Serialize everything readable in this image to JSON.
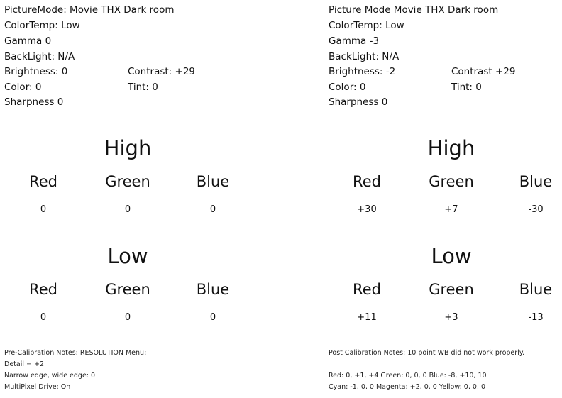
{
  "pre": {
    "settings": [
      "PictureMode: Movie THX Dark room",
      "ColorTemp: Low",
      "Gamma  0",
      "BackLight: N/A",
      "Brightness: 0",
      "Color: 0",
      "Sharpness  0"
    ],
    "contrast": "Contrast: +29",
    "tint": "Tint: 0",
    "high": {
      "title": "High",
      "labels": [
        "Red",
        "Green",
        "Blue"
      ],
      "values": [
        "0",
        "0",
        "0"
      ]
    },
    "low": {
      "title": "Low",
      "labels": [
        "Red",
        "Green",
        "Blue"
      ],
      "values": [
        "0",
        "0",
        "0"
      ]
    },
    "notes": [
      "Pre-Calibration Notes: RESOLUTION Menu:",
      "Detail = +2",
      "Narrow edge, wide edge: 0",
      "MultiPixel Drive: On"
    ]
  },
  "post": {
    "settings": [
      "Picture Mode  Movie THX Dark room",
      "ColorTemp: Low",
      "Gamma  -3",
      "BackLight: N/A",
      "Brightness: -2",
      "Color: 0",
      "Sharpness  0"
    ],
    "contrast": "Contrast  +29",
    "tint": "Tint: 0",
    "high": {
      "title": "High",
      "labels": [
        "Red",
        "Green",
        "Blue"
      ],
      "values": [
        "+30",
        "+7",
        "-30"
      ]
    },
    "low": {
      "title": "Low",
      "labels": [
        "Red",
        "Green",
        "Blue"
      ],
      "values": [
        "+11",
        "+3",
        "-13"
      ]
    },
    "notes": [
      "Post Calibration Notes: 10 point WB did not work properly.",
      "Red: 0, +1, +4 Green: 0, 0, 0 Blue: -8, +10, 10",
      "Cyan: -1, 0, 0 Magenta: +2, 0, 0 Yellow: 0, 0, 0"
    ]
  }
}
